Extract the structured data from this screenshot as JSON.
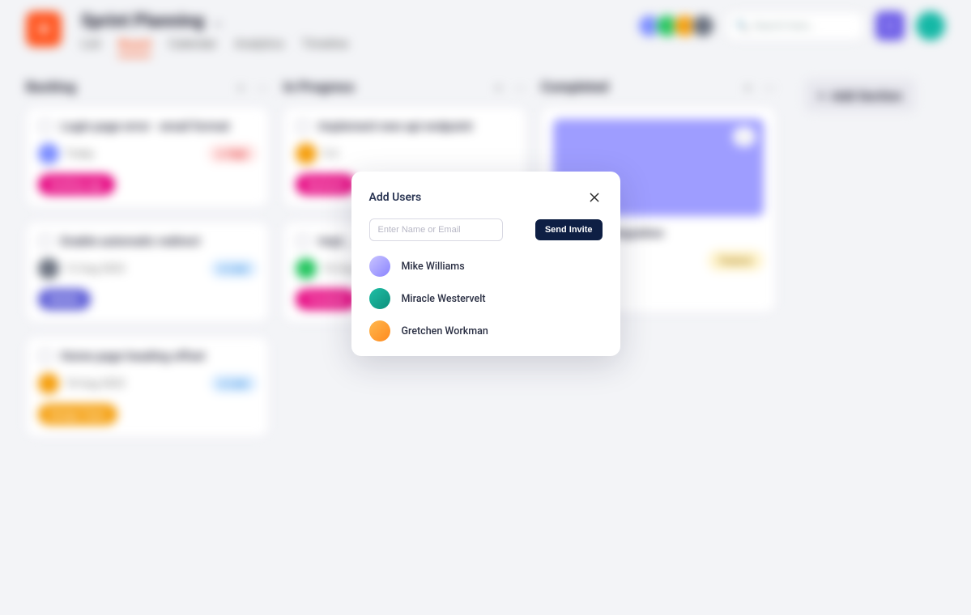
{
  "app": {
    "title": "Sprint Planning",
    "tabs": [
      "List",
      "Board",
      "Calendar",
      "Analytics",
      "Timeline"
    ],
    "active_tab": "Board",
    "search_placeholder": "Search here…",
    "add_section_label": "Add Section"
  },
  "columns": {
    "backlog": {
      "title": "Backlog",
      "cards": [
        {
          "title": "Login page error · email format",
          "date": "Today",
          "chip": "High",
          "tag": "Desktop app",
          "tag_color": "pink"
        },
        {
          "title": "Enable automatic redirect",
          "date": "12 Aug 2023",
          "chip": "Low",
          "tag": "Mobile",
          "tag_color": "purple"
        },
        {
          "title": "Home page heading offset",
          "date": "18 Aug 2023",
          "chip": "Low",
          "tag": "Design Team",
          "tag_color": "orange"
        }
      ]
    },
    "inprogress": {
      "title": "In Progress",
      "cards": [
        {
          "title": "Implement new api endpoint",
          "date": "5 d",
          "tag": "Backend",
          "tag_color": "pink"
        },
        {
          "title": "Impl…",
          "date": "16 Aug",
          "tag": "Frontend",
          "tag_color": "pink"
        }
      ]
    },
    "completed": {
      "title": "Completed",
      "cards": [
        {
          "title": "Calendar integration",
          "tag": "Feature",
          "tag_color": "yellow"
        }
      ]
    }
  },
  "modal": {
    "title": "Add Users",
    "input_placeholder": "Enter Name or Email",
    "send_label": "Send Invite",
    "users": [
      {
        "name": "Mike Williams"
      },
      {
        "name": "Miracle Westervelt"
      },
      {
        "name": "Gretchen Workman"
      }
    ]
  }
}
